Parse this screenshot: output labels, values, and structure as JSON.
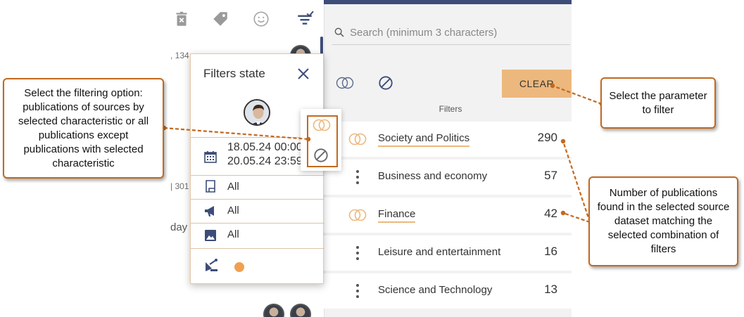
{
  "left_toolbar": {
    "icons": [
      "delete-icon",
      "tag-icon",
      "smiley-icon",
      "filter-check-icon"
    ],
    "colors": {
      "icon": "#9a9a9a",
      "filter_icon": "#3d4c78"
    }
  },
  "left_background": {
    "fragments": [
      ", 134",
      "| 301",
      "day"
    ]
  },
  "filters_popup": {
    "title": "Filters state",
    "date_from": "18.05.24 00:00",
    "date_to": "20.05.24 23:59",
    "rows": [
      {
        "icon": "document-icon",
        "value": "All"
      },
      {
        "icon": "megaphone-icon",
        "value": "All"
      },
      {
        "icon": "image-icon",
        "value": "All"
      }
    ],
    "footer_icons": [
      "satellite-icon",
      "globe-icon"
    ]
  },
  "search": {
    "placeholder": "Search (minimum 3 characters)"
  },
  "filter_mode": {
    "clear_label": "CLEAR"
  },
  "filters": {
    "label": "Filters",
    "items": [
      {
        "label": "Society and Politics",
        "count": "290",
        "mode": "intersect",
        "active": true
      },
      {
        "label": "Business and economy",
        "count": "57",
        "mode": "menu",
        "active": false
      },
      {
        "label": "Finance",
        "count": "42",
        "mode": "intersect",
        "active": true
      },
      {
        "label": "Leisure and entertainment",
        "count": "16",
        "mode": "menu",
        "active": false
      },
      {
        "label": "Science and Technology",
        "count": "13",
        "mode": "menu",
        "active": false
      }
    ]
  },
  "callouts": {
    "option": "Select the filtering option: publications of sources by selected characteristic or all publications except publications with selected characteristic",
    "parameter": "Select the parameter to filter",
    "count": "Number of publications found in the selected source dataset matching the selected combination of filters"
  },
  "colors": {
    "accent_orange": "#edb87d",
    "callout_border": "#c2691f",
    "navy": "#3d4c78",
    "panel_bg": "#f2f2f2"
  }
}
